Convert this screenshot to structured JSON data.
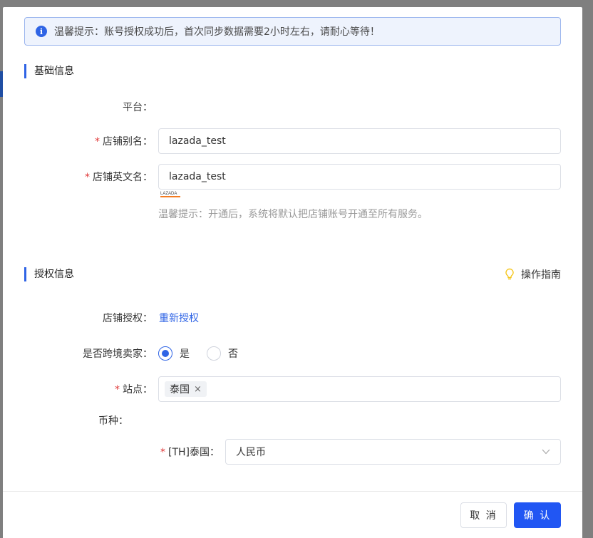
{
  "alert": {
    "text": "温馨提示：账号授权成功后，首次同步数据需要2小时左右，请耐心等待！"
  },
  "basic_section": {
    "title": "基础信息"
  },
  "platform": {
    "label": "平台：",
    "logo_text": "LAZADA"
  },
  "shop_alias": {
    "required_mark": "*",
    "label": "店铺别名：",
    "value": "lazada_test"
  },
  "shop_english_name": {
    "required_mark": "*",
    "label": "店铺英文名：",
    "value": "lazada_test"
  },
  "hint": {
    "text": "温馨提示：开通后，系统将默认把店铺账号开通至所有服务。"
  },
  "auth_section": {
    "title": "授权信息",
    "guide_label": "操作指南"
  },
  "shop_auth": {
    "label": "店铺授权：",
    "link": "重新授权"
  },
  "cross_border": {
    "label": "是否跨境卖家：",
    "options": [
      "是",
      "否"
    ],
    "selected": "是"
  },
  "site": {
    "required_mark": "*",
    "label": "站点：",
    "tag": "泰国",
    "tag_close": "×"
  },
  "currency": {
    "label": "币种："
  },
  "th_currency": {
    "required_mark": "*",
    "label": "[TH]泰国：",
    "value": "人民币"
  },
  "footer": {
    "cancel_label": "取 消",
    "ok_label": "确 认"
  },
  "colors": {
    "primary": "#2f64e5",
    "required": "#e03a3a",
    "hint": "#999999"
  }
}
